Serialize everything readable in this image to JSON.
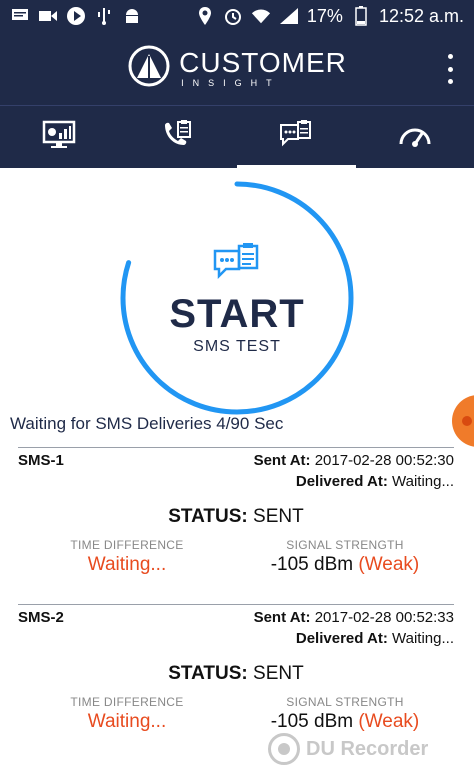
{
  "statusbar": {
    "icons_left": [
      "message-icon",
      "video-icon",
      "play-icon",
      "usb-icon",
      "android-icon"
    ],
    "icons_right": [
      "location-icon",
      "alarm-icon",
      "wifi-icon",
      "signal-icon",
      "battery-icon"
    ],
    "battery": "17%",
    "time": "12:52 a.m."
  },
  "app": {
    "brand_title": "CUSTOMER",
    "brand_subtitle": "INSIGHT",
    "colors": {
      "header": "#1f2a48",
      "accent": "#2196f3",
      "warning": "#e84b1f"
    }
  },
  "tabs": [
    {
      "icon": "dashboard-icon",
      "active": false
    },
    {
      "icon": "phone-test-icon",
      "active": false
    },
    {
      "icon": "sms-test-icon",
      "active": true
    },
    {
      "icon": "speed-test-icon",
      "active": false
    }
  ],
  "start": {
    "label": "START",
    "sub_label": "SMS TEST",
    "progress": 0.8
  },
  "waiting_text": "Waiting for SMS Deliveries 4/90 Sec",
  "sms": [
    {
      "id": "SMS-1",
      "sent_label": "Sent At:",
      "sent_at": "2017-02-28 00:52:30",
      "delivered_label": "Delivered At:",
      "delivered_at": "Waiting...",
      "status_label": "STATUS:",
      "status": "SENT",
      "time_diff_label": "TIME DIFFERENCE",
      "time_diff": "Waiting...",
      "signal_label": "SIGNAL STRENGTH",
      "signal_value": "-105 dBm",
      "signal_quality": "(Weak)"
    },
    {
      "id": "SMS-2",
      "sent_label": "Sent At:",
      "sent_at": "2017-02-28 00:52:33",
      "delivered_label": "Delivered At:",
      "delivered_at": "Waiting...",
      "status_label": "STATUS:",
      "status": "SENT",
      "time_diff_label": "TIME DIFFERENCE",
      "time_diff": "Waiting...",
      "signal_label": "SIGNAL STRENGTH",
      "signal_value": "-105 dBm",
      "signal_quality": "(Weak)"
    }
  ],
  "watermark": "DU Recorder"
}
